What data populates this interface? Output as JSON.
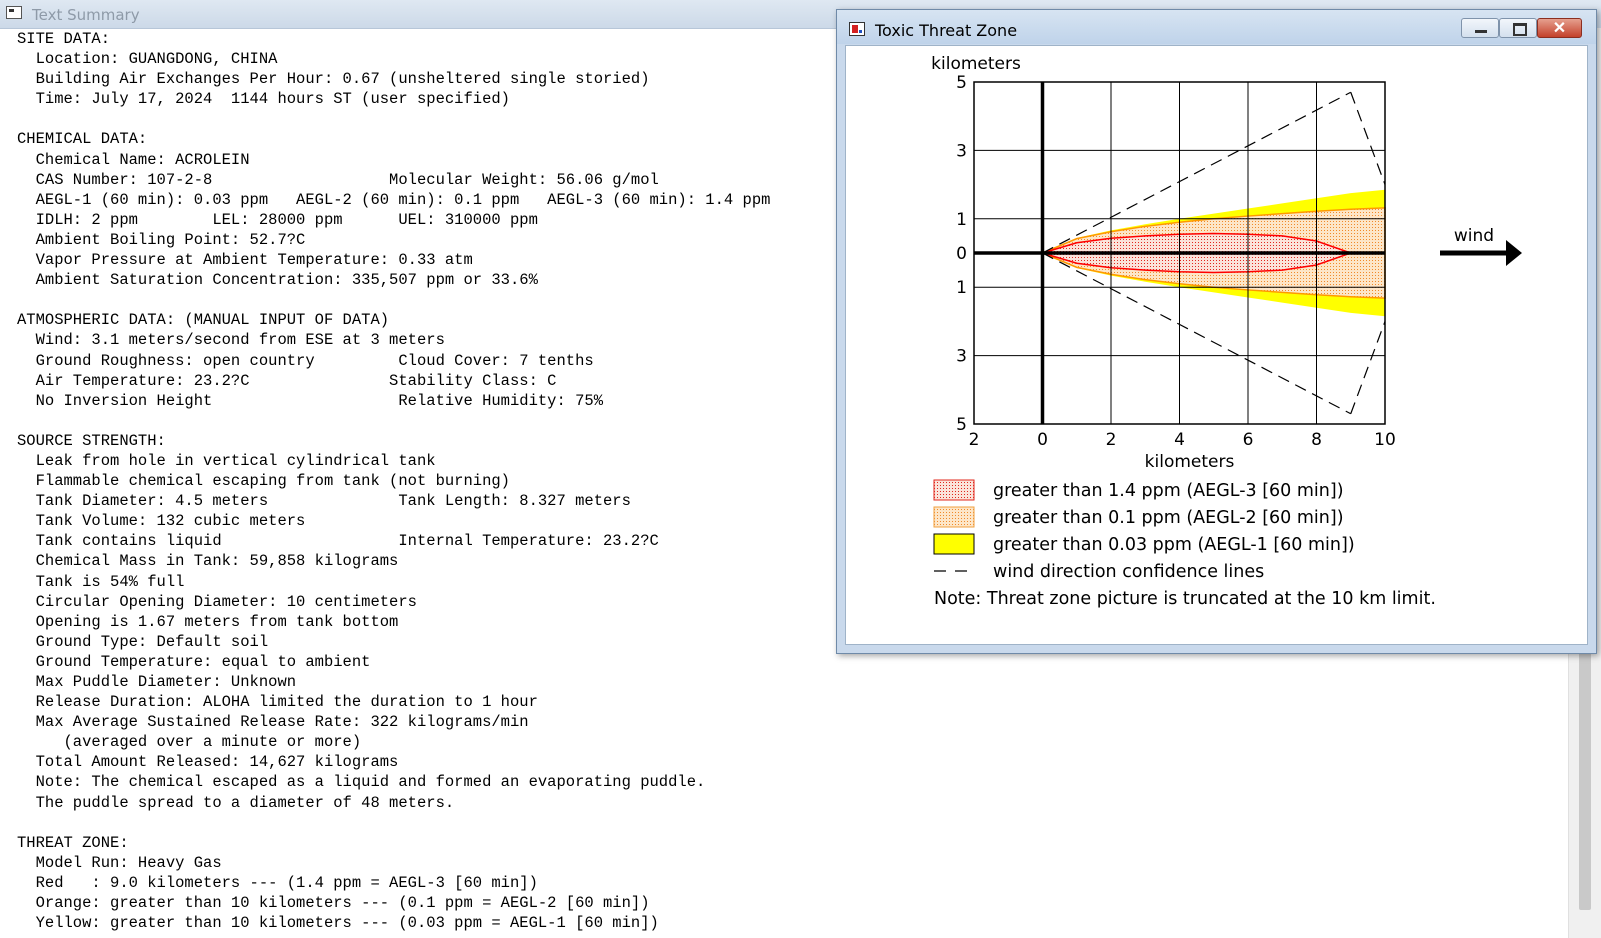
{
  "text_summary": {
    "title": "Text Summary",
    "lines": [
      "SITE DATA:",
      "  Location: GUANGDONG, CHINA",
      "  Building Air Exchanges Per Hour: 0.67 (unsheltered single storied)",
      "  Time: July 17, 2024  1144 hours ST (user specified)",
      "",
      "CHEMICAL DATA:",
      "  Chemical Name: ACROLEIN",
      "  CAS Number: 107-2-8                   Molecular Weight: 56.06 g/mol",
      "  AEGL-1 (60 min): 0.03 ppm   AEGL-2 (60 min): 0.1 ppm   AEGL-3 (60 min): 1.4 ppm",
      "  IDLH: 2 ppm        LEL: 28000 ppm      UEL: 310000 ppm",
      "  Ambient Boiling Point: 52.7?C",
      "  Vapor Pressure at Ambient Temperature: 0.33 atm",
      "  Ambient Saturation Concentration: 335,507 ppm or 33.6%",
      "",
      "ATMOSPHERIC DATA: (MANUAL INPUT OF DATA)",
      "  Wind: 3.1 meters/second from ESE at 3 meters",
      "  Ground Roughness: open country         Cloud Cover: 7 tenths",
      "  Air Temperature: 23.2?C               Stability Class: C",
      "  No Inversion Height                    Relative Humidity: 75%",
      "",
      "SOURCE STRENGTH:",
      "  Leak from hole in vertical cylindrical tank",
      "  Flammable chemical escaping from tank (not burning)",
      "  Tank Diameter: 4.5 meters              Tank Length: 8.327 meters",
      "  Tank Volume: 132 cubic meters",
      "  Tank contains liquid                   Internal Temperature: 23.2?C",
      "  Chemical Mass in Tank: 59,858 kilograms",
      "  Tank is 54% full",
      "  Circular Opening Diameter: 10 centimeters",
      "  Opening is 1.67 meters from tank bottom",
      "  Ground Type: Default soil",
      "  Ground Temperature: equal to ambient",
      "  Max Puddle Diameter: Unknown",
      "  Release Duration: ALOHA limited the duration to 1 hour",
      "  Max Average Sustained Release Rate: 322 kilograms/min",
      "     (averaged over a minute or more)",
      "  Total Amount Released: 14,627 kilograms",
      "  Note: The chemical escaped as a liquid and formed an evaporating puddle.",
      "  The puddle spread to a diameter of 48 meters.",
      "",
      "THREAT ZONE:",
      "  Model Run: Heavy Gas",
      "  Red   : 9.0 kilometers --- (1.4 ppm = AEGL-3 [60 min])",
      "  Orange: greater than 10 kilometers --- (0.1 ppm = AEGL-2 [60 min])",
      "  Yellow: greater than 10 kilometers --- (0.03 ppm = AEGL-1 [60 min])"
    ]
  },
  "threat_zone_window": {
    "title": "Toxic Threat Zone",
    "close_glyph": "✕",
    "chart_data": {
      "type": "area",
      "y_axis_title": "kilometers",
      "x_axis_title": "kilometers",
      "x_range": [
        -2,
        10
      ],
      "y_range": [
        -5,
        5
      ],
      "x_tick_labels": [
        "2",
        "0",
        "2",
        "4",
        "6",
        "8",
        "10"
      ],
      "y_tick_labels": [
        "5",
        "3",
        "1",
        "0",
        "1",
        "3",
        "5"
      ],
      "grid": true,
      "wind_label": "wind",
      "zones": [
        {
          "name": "red",
          "color": "#ff0000",
          "fill": "#fbe0d4",
          "extent_km": 9.0,
          "upper": [
            [
              0,
              0
            ],
            [
              1,
              0.3
            ],
            [
              2,
              0.43
            ],
            [
              3,
              0.5
            ],
            [
              4,
              0.55
            ],
            [
              5,
              0.57
            ],
            [
              6,
              0.55
            ],
            [
              7,
              0.5
            ],
            [
              8,
              0.35
            ],
            [
              9,
              0
            ]
          ],
          "lower": [
            [
              0,
              0
            ],
            [
              1,
              -0.3
            ],
            [
              2,
              -0.43
            ],
            [
              3,
              -0.5
            ],
            [
              4,
              -0.55
            ],
            [
              5,
              -0.57
            ],
            [
              6,
              -0.55
            ],
            [
              7,
              -0.5
            ],
            [
              8,
              -0.35
            ],
            [
              9,
              0
            ]
          ]
        },
        {
          "name": "orange",
          "color": "#ff9900",
          "fill": "#fce0bc",
          "upper": [
            [
              0,
              0
            ],
            [
              1,
              0.42
            ],
            [
              2,
              0.62
            ],
            [
              3,
              0.78
            ],
            [
              4,
              0.9
            ],
            [
              5,
              1.0
            ],
            [
              6,
              1.08
            ],
            [
              7,
              1.15
            ],
            [
              8,
              1.22
            ],
            [
              9,
              1.28
            ],
            [
              10,
              1.32
            ]
          ],
          "lower": [
            [
              0,
              0
            ],
            [
              1,
              -0.42
            ],
            [
              2,
              -0.62
            ],
            [
              3,
              -0.78
            ],
            [
              4,
              -0.9
            ],
            [
              5,
              -1.0
            ],
            [
              6,
              -1.08
            ],
            [
              7,
              -1.15
            ],
            [
              8,
              -1.22
            ],
            [
              9,
              -1.28
            ],
            [
              10,
              -1.32
            ]
          ]
        },
        {
          "name": "yellow",
          "color": "#ffff00",
          "fill": "#ffff00",
          "upper": [
            [
              0,
              0
            ],
            [
              1,
              0.44
            ],
            [
              2,
              0.66
            ],
            [
              3,
              0.84
            ],
            [
              4,
              1.0
            ],
            [
              5,
              1.15
            ],
            [
              6,
              1.3
            ],
            [
              7,
              1.45
            ],
            [
              8,
              1.6
            ],
            [
              9,
              1.75
            ],
            [
              10,
              1.85
            ]
          ],
          "lower": [
            [
              0,
              0
            ],
            [
              1,
              -0.44
            ],
            [
              2,
              -0.66
            ],
            [
              3,
              -0.84
            ],
            [
              4,
              -1.0
            ],
            [
              5,
              -1.15
            ],
            [
              6,
              -1.3
            ],
            [
              7,
              -1.45
            ],
            [
              8,
              -1.6
            ],
            [
              9,
              -1.75
            ],
            [
              10,
              -1.85
            ]
          ]
        }
      ],
      "confidence_lines": {
        "upper": [
          [
            0,
            0
          ],
          [
            9,
            4.7
          ]
        ],
        "lower": [
          [
            0,
            0
          ],
          [
            9,
            -4.7
          ]
        ],
        "arc_upper": [
          [
            9,
            4.7
          ],
          [
            10,
            2.0
          ]
        ],
        "arc_lower": [
          [
            9,
            -4.7
          ],
          [
            10,
            -2.0
          ]
        ]
      },
      "legend": [
        {
          "swatch": "red-dots",
          "label": "greater than 1.4 ppm (AEGL-3 [60 min])"
        },
        {
          "swatch": "orange-dots",
          "label": "greater than 0.1 ppm (AEGL-2 [60 min])"
        },
        {
          "swatch": "yellow-solid",
          "label": "greater than 0.03 ppm (AEGL-1 [60 min])"
        },
        {
          "swatch": "dashed",
          "label": "wind direction confidence lines"
        }
      ],
      "note": "Note: Threat zone picture is truncated at the 10 km limit."
    }
  }
}
